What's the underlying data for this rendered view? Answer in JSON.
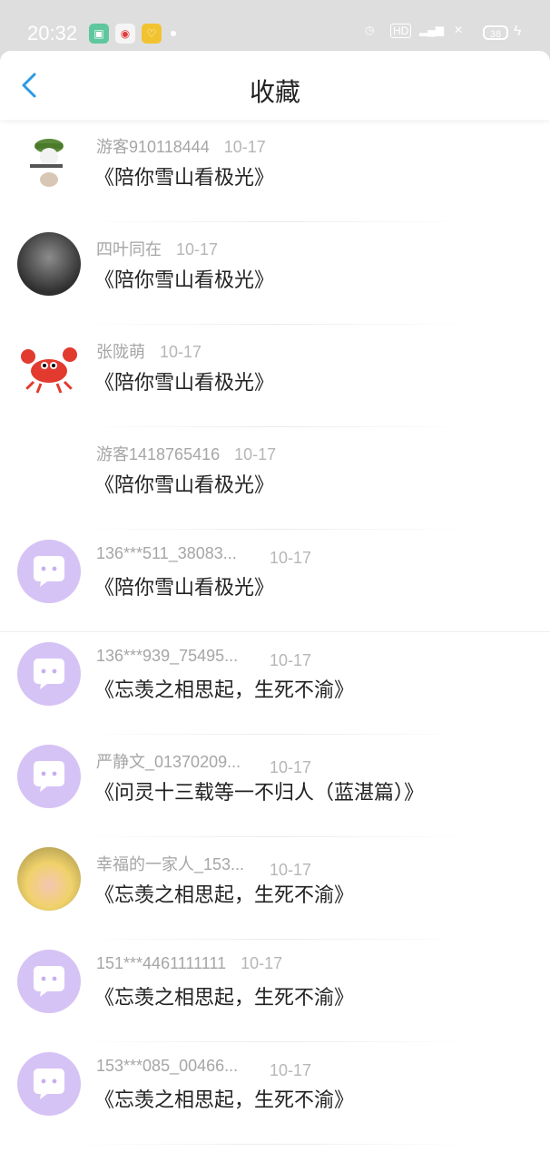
{
  "status_bar": {
    "time": "20:32",
    "battery": "38",
    "app_icons": [
      "app-icon",
      "weibo-icon",
      "badge-icon"
    ]
  },
  "header": {
    "title": "收藏"
  },
  "items": [
    {
      "name": "游客910118444",
      "date": "10-17",
      "title": "《陪你雪山看极光》",
      "avatar": "soldier-avatar"
    },
    {
      "name": "四叶同在",
      "date": "10-17",
      "title": "《陪你雪山看极光》",
      "avatar": "photo-avatar"
    },
    {
      "name": "张陇萌",
      "date": "10-17",
      "title": "《陪你雪山看极光》",
      "avatar": "crab-avatar"
    },
    {
      "name": "游客1418765416",
      "date": "10-17",
      "title": "《陪你雪山看极光》",
      "avatar": "blank-avatar"
    },
    {
      "name": "136***511_38083...",
      "date": "10-17",
      "title": "《陪你雪山看极光》",
      "avatar": "default-avatar"
    },
    {
      "name": "136***939_75495...",
      "date": "10-17",
      "title": "《忘羡之相思起，生死不渝》",
      "avatar": "default-avatar"
    },
    {
      "name": "严静文_01370209...",
      "date": "10-17",
      "title": "《问灵十三载等一不归人（蓝湛篇）》",
      "avatar": "default-avatar"
    },
    {
      "name": "幸福的一家人_153...",
      "date": "10-17",
      "title": "《忘羡之相思起，生死不渝》",
      "avatar": "photo-avatar"
    },
    {
      "name": "151***4461111111",
      "date": "10-17",
      "title": "《忘羡之相思起，生死不渝》",
      "avatar": "default-avatar"
    },
    {
      "name": "153***085_00466...",
      "date": "10-17",
      "title": "《忘羡之相思起，生死不渝》",
      "avatar": "default-avatar"
    }
  ]
}
